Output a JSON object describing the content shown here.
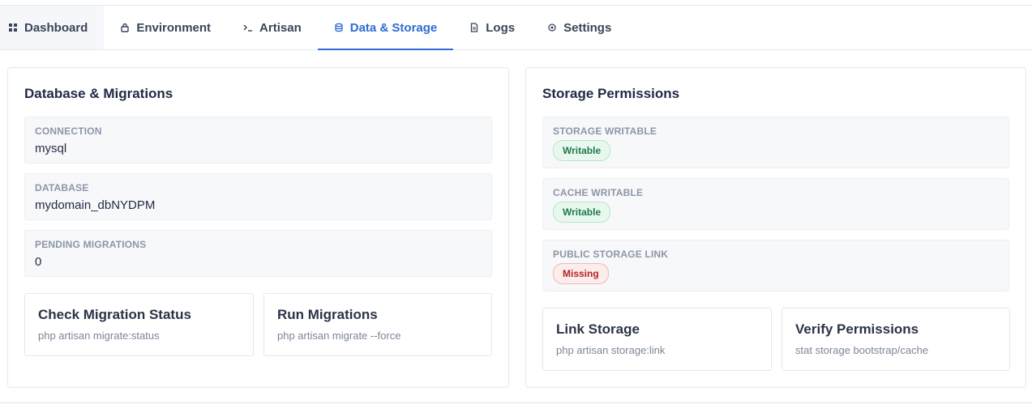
{
  "tabs": [
    {
      "label": "Dashboard",
      "icon": "grid-icon"
    },
    {
      "label": "Environment",
      "icon": "lock-icon"
    },
    {
      "label": "Artisan",
      "icon": "terminal-icon"
    },
    {
      "label": "Data & Storage",
      "icon": "database-icon",
      "active": true
    },
    {
      "label": "Logs",
      "icon": "file-icon"
    },
    {
      "label": "Settings",
      "icon": "gear-icon"
    }
  ],
  "database": {
    "title": "Database & Migrations",
    "fields": [
      {
        "label": "CONNECTION",
        "value": "mysql"
      },
      {
        "label": "DATABASE",
        "value": "mydomain_dbNYDPM"
      },
      {
        "label": "PENDING MIGRATIONS",
        "value": "0"
      }
    ],
    "actions": [
      {
        "title": "Check Migration Status",
        "command": "php artisan migrate:status"
      },
      {
        "title": "Run Migrations",
        "command": "php artisan migrate --force"
      }
    ]
  },
  "storage": {
    "title": "Storage Permissions",
    "fields": [
      {
        "label": "STORAGE WRITABLE",
        "status": "Writable",
        "status_color": "#1d7a48"
      },
      {
        "label": "CACHE WRITABLE",
        "status": "Writable",
        "status_color": "#1d7a48"
      },
      {
        "label": "PUBLIC STORAGE LINK",
        "status": "Missing",
        "status_color": "#b42323"
      }
    ],
    "actions": [
      {
        "title": "Link Storage",
        "command": "php artisan storage:link"
      },
      {
        "title": "Verify Permissions",
        "command": "stat storage bootstrap/cache"
      }
    ]
  },
  "colors": {
    "accent": "#2f6bd6",
    "ok": "#1d7a48",
    "bad": "#b42323"
  }
}
